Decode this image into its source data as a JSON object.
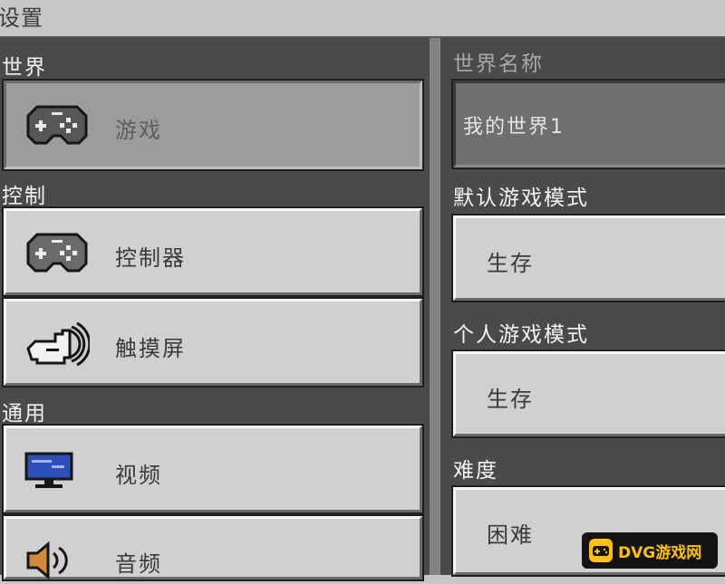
{
  "window": {
    "title": "设置"
  },
  "left": {
    "sections": [
      {
        "label": "世界",
        "items": [
          {
            "label": "游戏",
            "icon": "gamepad-icon",
            "selected": true
          }
        ]
      },
      {
        "label": "控制",
        "items": [
          {
            "label": "控制器",
            "icon": "gamepad-icon"
          },
          {
            "label": "触摸屏",
            "icon": "touch-hand-icon"
          }
        ]
      },
      {
        "label": "通用",
        "items": [
          {
            "label": "视频",
            "icon": "monitor-icon"
          },
          {
            "label": "音频",
            "icon": "speaker-icon"
          }
        ]
      }
    ]
  },
  "right": {
    "world_name": {
      "label": "世界名称",
      "value": "我的世界1"
    },
    "default_game_mode": {
      "label": "默认游戏模式",
      "value": "生存"
    },
    "personal_game_mode": {
      "label": "个人游戏模式",
      "value": "生存"
    },
    "difficulty": {
      "label": "难度",
      "value": "困难"
    }
  },
  "watermark": {
    "text": "DVG游戏网",
    "icon": "gamepad-icon"
  },
  "colors": {
    "panel_bg": "#4a4a4a",
    "button_bg": "#d0d0d0",
    "selected_bg": "#9c9c9c",
    "badge_accent": "#ffc107"
  }
}
